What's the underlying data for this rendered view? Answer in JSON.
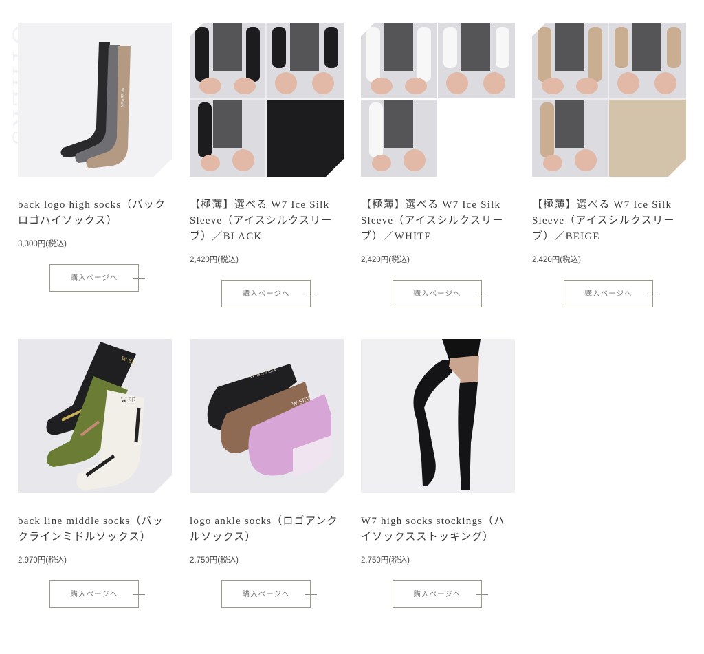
{
  "section_label": "OTHERS",
  "button_label": "購入ページへ",
  "products": [
    {
      "name": "back logo high socks（バックロゴハイソックス）",
      "price": "3,300円(税込)",
      "image": "three-high-socks"
    },
    {
      "name": "【極薄】選べる W7 Ice Silk Sleeve（アイスシルクスリーブ）／BLACK",
      "price": "2,420円(税込)",
      "image": "arm-sleeve-black"
    },
    {
      "name": "【極薄】選べる W7 Ice Silk Sleeve（アイスシルクスリーブ）／WHITE",
      "price": "2,420円(税込)",
      "image": "arm-sleeve-white"
    },
    {
      "name": "【極薄】選べる W7 Ice Silk Sleeve（アイスシルクスリーブ）／BEIGE",
      "price": "2,420円(税込)",
      "image": "arm-sleeve-beige"
    },
    {
      "name": "back line middle socks（バックラインミドルソックス）",
      "price": "2,970円(税込)",
      "image": "middle-socks"
    },
    {
      "name": "logo ankle socks（ロゴアンクルソックス）",
      "price": "2,750円(税込)",
      "image": "ankle-socks"
    },
    {
      "name": "W7 high socks stockings（ハイソックスストッキング）",
      "price": "2,750円(税込)",
      "image": "stocking-legs"
    }
  ],
  "colors": {
    "sleeve_black": "#1c1c1e",
    "sleeve_white": "#f7f7f7",
    "sleeve_beige": "#c9ae91",
    "sock_black": "#1f1f22",
    "sock_green": "#6b7d35",
    "sock_white": "#f1efe8",
    "sock_brown": "#8f6a52",
    "sock_pink": "#d7a6d6"
  }
}
